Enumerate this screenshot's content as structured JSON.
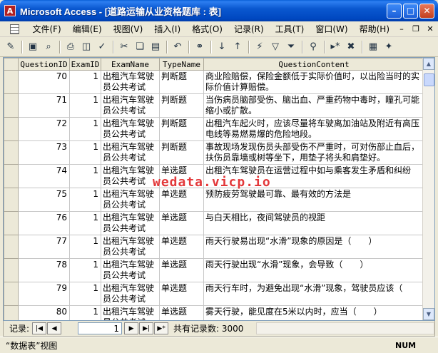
{
  "window": {
    "title": "Microsoft Access - [道路运输从业资格题库 : 表]",
    "app_icon": "access-icon",
    "buttons": [
      "minimize-icon",
      "maximize-icon",
      "close-icon"
    ],
    "accent": "#0a58d0"
  },
  "menu": {
    "items": [
      "文件(F)",
      "编辑(E)",
      "视图(V)",
      "插入(I)",
      "格式(O)",
      "记录(R)",
      "工具(T)",
      "窗口(W)",
      "帮助(H)"
    ]
  },
  "toolbar": {
    "icons": [
      "view-icon",
      "save-icon",
      "search-file-icon",
      "print-icon",
      "print-preview-icon",
      "spelling-icon",
      "cut-icon",
      "copy-icon",
      "paste-icon",
      "undo-icon",
      "hyperlink-icon",
      "sort-ascending-icon",
      "sort-descending-icon",
      "filter-by-selection-icon",
      "filter-by-form-icon",
      "apply-filter-icon",
      "find-icon",
      "new-record-icon",
      "delete-record-icon",
      "database-window-icon",
      "new-object-icon"
    ]
  },
  "table": {
    "columns": [
      "QuestionID",
      "ExamID",
      "ExamName",
      "TypeName",
      "QuestionContent"
    ],
    "rows": [
      {
        "id": "70",
        "exam": "1",
        "name": "出租汽车驾驶员公共考试",
        "type": "判断题",
        "content": "商业险赔偿，保险金额低于实际价值时，以出险当时的实际价值计算赔偿。"
      },
      {
        "id": "71",
        "exam": "1",
        "name": "出租汽车驾驶员公共考试",
        "type": "判断题",
        "content": "当伤病员脑部受伤、脑出血、严重药物中毒时，瞳孔可能缩小或扩散。"
      },
      {
        "id": "72",
        "exam": "1",
        "name": "出租汽车驾驶员公共考试",
        "type": "判断题",
        "content": "出租汽车起火时，应该尽量将车驶离加油站及附近有高压电线等易燃易爆的危险地段。"
      },
      {
        "id": "73",
        "exam": "1",
        "name": "出租汽车驾驶员公共考试",
        "type": "判断题",
        "content": "事故现场发现伤员头部受伤不严重时，可对伤部止血后，扶伤员靠墙或树等坐下，用垫子将头和肩垫好。"
      },
      {
        "id": "74",
        "exam": "1",
        "name": "出租汽车驾驶员公共考试",
        "type": "单选题",
        "content": "出租汽车驾驶员在运营过程中如与乘客发生矛盾和纠纷"
      },
      {
        "id": "75",
        "exam": "1",
        "name": "出租汽车驾驶员公共考试",
        "type": "单选题",
        "content": "预防疲劳驾驶最可靠、最有效的方法是"
      },
      {
        "id": "76",
        "exam": "1",
        "name": "出租汽车驾驶员公共考试",
        "type": "单选题",
        "content": "与白天相比，夜间驾驶员的视距"
      },
      {
        "id": "77",
        "exam": "1",
        "name": "出租汽车驾驶员公共考试",
        "type": "单选题",
        "content": "雨天行驶易出现“水滑”现象的原因是（　　）"
      },
      {
        "id": "78",
        "exam": "1",
        "name": "出租汽车驾驶员公共考试",
        "type": "单选题",
        "content": "雨天行驶出现“水滑”现象，会导致（　　）"
      },
      {
        "id": "79",
        "exam": "1",
        "name": "出租汽车驾驶员公共考试",
        "type": "单选题",
        "content": "雨天行车时，为避免出现“水滑”现象，驾驶员应该（"
      },
      {
        "id": "80",
        "exam": "1",
        "name": "出租汽车驾驶员公共考试",
        "type": "单选题",
        "content": "雾天行驶，能见度在5米以内时，应当（　　）"
      }
    ]
  },
  "watermark": "wedata.vicp.io",
  "navigation": {
    "label": "记录:",
    "current": "1",
    "total_text": "共有记录数: 3000",
    "buttons": [
      "first-record-icon",
      "previous-record-icon",
      "next-record-icon",
      "last-record-icon",
      "new-record-nav-icon"
    ]
  },
  "status": {
    "view": "“数据表”视图",
    "num": "NUM"
  }
}
